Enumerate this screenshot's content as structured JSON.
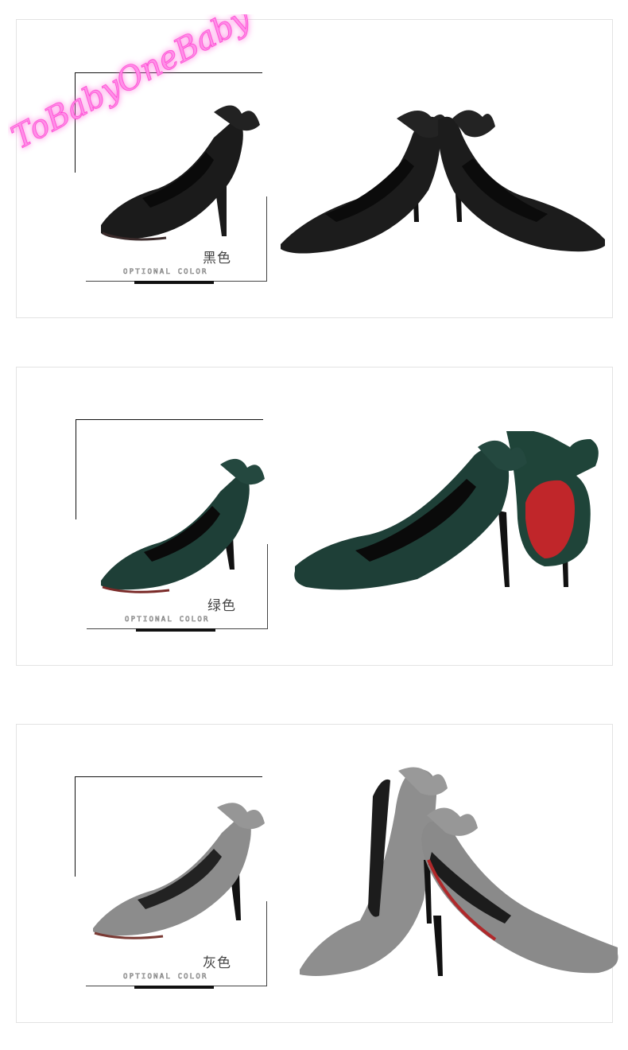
{
  "watermark": {
    "text": "ToBabyOneBaby"
  },
  "caption": "OPTIONAL COLOR",
  "panels": [
    {
      "color_name": "黑色",
      "swatch": "#1b1b1b",
      "sole": "#2b2b2b"
    },
    {
      "color_name": "绿色",
      "swatch": "#1e3f37",
      "sole": "#c0262a"
    },
    {
      "color_name": "灰色",
      "swatch": "#8a8a8a",
      "sole": "#b0282a"
    }
  ]
}
